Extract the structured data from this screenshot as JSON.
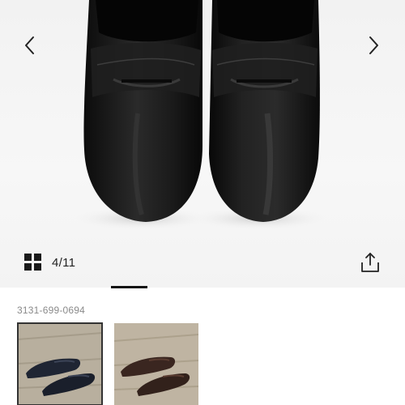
{
  "gallery": {
    "image_alt": "Black leather penny loafers",
    "prev_icon": "chevron-left-icon",
    "next_icon": "chevron-right-icon",
    "grid_icon": "grid-view-icon",
    "counter": "4/11",
    "share_icon": "share-icon"
  },
  "product": {
    "sku": "3131-699-0694"
  },
  "variants": [
    {
      "color_name": "navy",
      "swatch": "#1f2533"
    },
    {
      "color_name": "brown",
      "swatch": "#3a2620"
    }
  ],
  "colors": {
    "text": "#222222",
    "sku_text": "#8a8a8a",
    "indicator": "#111111"
  }
}
